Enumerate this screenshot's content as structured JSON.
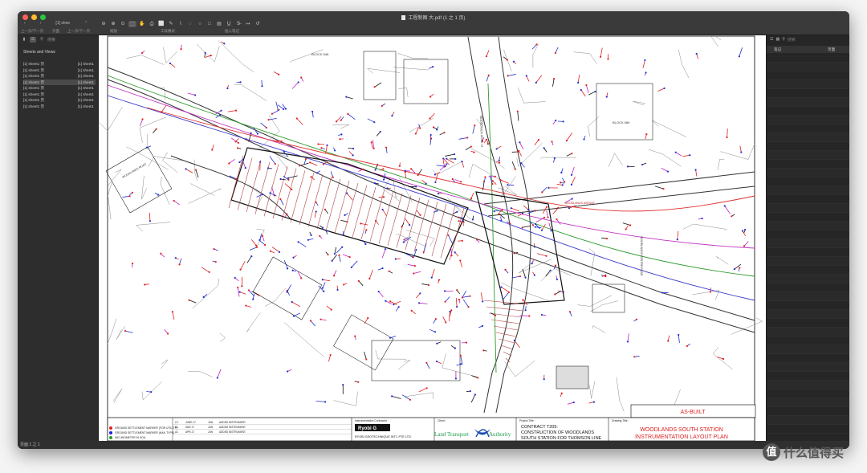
{
  "window": {
    "title": "工程制图 大.pdf (1 之 1 页)",
    "traffic_lights": [
      "#ff5f57",
      "#febc2e",
      "#28c840"
    ]
  },
  "toolbar": {
    "nav_sheet": "[1] shee",
    "nav_prev_next_label": "上一页/下一页",
    "page_label": "页面",
    "prev_next_label2": "上一页/下一页",
    "zoom_label": "缩放",
    "tools_label": "工具模式",
    "insert_note_label": "插入笔记",
    "tool_icons": [
      "zoom-out-icon",
      "zoom-in-icon",
      "zoom-fit-icon",
      "select-icon",
      "hand-icon",
      "print-icon",
      "rect-select-icon",
      "pen-icon",
      "annotate-icon",
      "lasso-icon",
      "shape-circle-icon",
      "shape-rect-icon",
      "highlight-icon",
      "underline-icon",
      "strike-icon",
      "arrow-icon",
      "undo-icon"
    ],
    "tool_glyphs": [
      "⊖",
      "⊕",
      "⊙",
      "⬚",
      "✋",
      "⎙",
      "⬜",
      "✎",
      "⌇",
      "◌",
      "○",
      "□",
      "▤",
      "U̲",
      "S̶",
      "↦",
      "↺"
    ]
  },
  "sidebar": {
    "search_placeholder": "搜索",
    "heading": "Sheets and Views",
    "items": [
      {
        "name": "[1] sheet1 页",
        "tag": "[1] sheet1"
      },
      {
        "name": "[1] sheet1 页",
        "tag": "[1] sheet1"
      },
      {
        "name": "[1] sheet1 页",
        "tag": "[1] sheet1"
      },
      {
        "name": "[1] sheet1 页",
        "tag": "[1] sheet1"
      },
      {
        "name": "[1] sheet1 页",
        "tag": "[1] sheet1"
      },
      {
        "name": "[1] sheet1 页",
        "tag": "[1] sheet1"
      },
      {
        "name": "[1] sheet1 页",
        "tag": "[1] sheet1"
      },
      {
        "name": "[1] sheet1 页",
        "tag": "[1] sheet1"
      }
    ],
    "selected_index": 3
  },
  "right_panel": {
    "search_placeholder": "搜索",
    "col_notes": "笔记",
    "col_page": "页面"
  },
  "drawing": {
    "labels": {
      "block_548": "BLOCK 548",
      "block_589": "BLOCK 589",
      "woodlands_ave": "WOODLANDS AVENUE",
      "woodlands_dr": "WOODLANDS DRIVE 14",
      "woodlands_cen": "WOODLANDS CENTRE ROAD",
      "woodlands_rd": "WOODLANDS ROAD",
      "as_built": "AS-BUILT"
    },
    "title_block": {
      "legend_1": "GROUND SETTLEMENT MARKER (FOR UTILITY)",
      "legend_2": "GROUND SETTLEMENT MARKER (NAIL TYPE)",
      "legend_3": "INCLINOMETER IN SOIL",
      "contractor_label": "Instrumentation Contractor :",
      "contractor_logo": "Ryobi G",
      "contractor_name": "RYOBI GEOTECHNIQUE INT'L PTE LTD",
      "client_label": "Client :",
      "client_name_1": "Land Transport",
      "client_name_2": "Authority",
      "project_label": "Project Title :",
      "project_1": "CONTRACT T205:",
      "project_2": "CONSTRUCTION OF WOODLANDS",
      "project_3": "SOUTH STATION FOR THOMSON LINE",
      "drawing_label": "Drawing Title :",
      "drawing_1": "WOODLANDS SOUTH STATION",
      "drawing_2": "INSTRUMENTATION LAYOUT PLAN",
      "rev_rows": [
        {
          "rev": "C1",
          "date": "JUNE-17",
          "by": "JLW",
          "desc": "ADDED INSTRUMENT"
        },
        {
          "rev": "B1",
          "date": "MAY-17",
          "by": "JLW",
          "desc": "ADDED INSTRUMENT"
        },
        {
          "rev": "A1",
          "date": "APR-17",
          "by": "JLW",
          "desc": "ADDED INSTRUMENT"
        }
      ]
    }
  },
  "status_bar": {
    "page": "页面 1 之 1"
  },
  "watermark": {
    "glyph": "值",
    "text": "什么值得买"
  }
}
